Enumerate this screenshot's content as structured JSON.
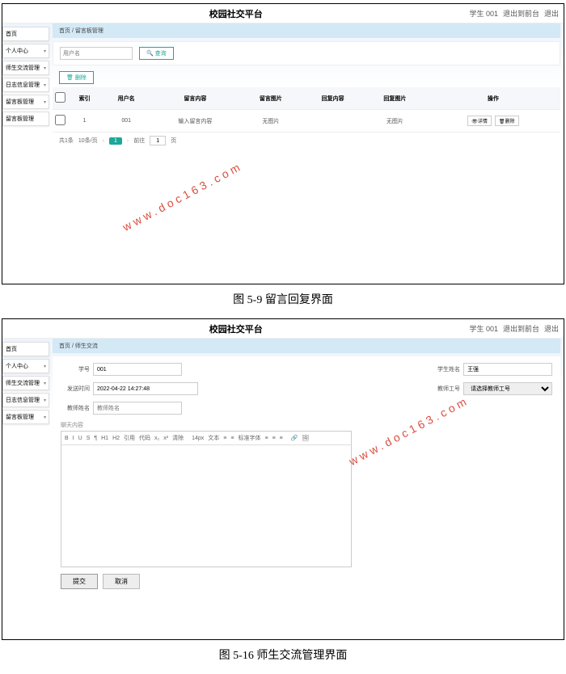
{
  "watermark": "www.doc163.com",
  "fig1": {
    "caption": "图 5-9 留言回复界面",
    "header": {
      "title": "校园社交平台",
      "user": "学生 001",
      "logout": "退出到前台",
      "exit": "退出"
    },
    "sidebar": [
      "首页",
      "个人中心",
      "师生交流管理",
      "日志信息管理",
      "留言板管理",
      "留言板管理"
    ],
    "crumb": "首页 / 留言板管理",
    "search": {
      "placeholder": "用户名",
      "btn": "查询"
    },
    "delete_btn": "删除",
    "columns": [
      "索引",
      "用户名",
      "留言内容",
      "留言图片",
      "回复内容",
      "回复图片",
      "操作"
    ],
    "row": {
      "idx": "1",
      "user": "001",
      "msg": "输入留言内容",
      "img": "无图片",
      "reply": "",
      "rimg": "无图片"
    },
    "ops": {
      "detail": "详情",
      "del": "删除"
    },
    "pager": {
      "total": "共1条",
      "perpage": "10条/页",
      "page": "1",
      "jump": "前往",
      "pages": "页",
      "cur": "1"
    }
  },
  "fig2": {
    "caption": "图 5-16 师生交流管理界面",
    "header": {
      "title": "校园社交平台",
      "user": "学生 001",
      "logout": "退出到前台",
      "exit": "退出"
    },
    "sidebar": [
      "首页",
      "个人中心",
      "师生交流管理",
      "日志信息管理",
      "留言板管理"
    ],
    "crumb": "首页 / 师生交流",
    "labels": {
      "sid": "学号",
      "sname": "学生姓名",
      "time": "发送时间",
      "tid": "教师工号",
      "tname": "教师姓名",
      "content": "聊天内容"
    },
    "values": {
      "sid": "001",
      "sname": "王强",
      "time": "2022-04-22 14:27:48",
      "tid_ph": "请选择教师工号",
      "tname_ph": "教师姓名"
    },
    "toolbar1": [
      "B",
      "I",
      "U",
      "S",
      "¶",
      "H1",
      "H2",
      "引用",
      "代码",
      "x₂",
      "x²",
      "清除"
    ],
    "toolbar2": [
      "14px",
      "文本",
      "≡",
      "≡",
      "标准字体",
      "≡",
      "≡",
      "≡"
    ],
    "toolbar3": [
      "🔗",
      "🖼"
    ],
    "buttons": {
      "submit": "提交",
      "cancel": "取消"
    }
  }
}
